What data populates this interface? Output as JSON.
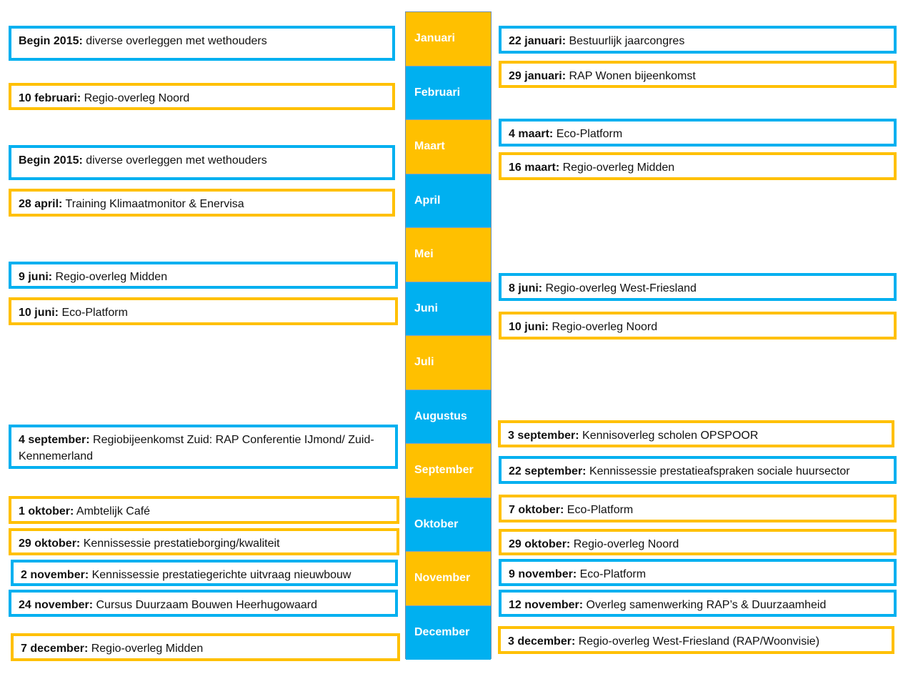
{
  "colors": {
    "blue": "#00B0F0",
    "orange": "#FFC000"
  },
  "months": [
    "Januari",
    "Februari",
    "Maart",
    "April",
    "Mei",
    "Juni",
    "Juli",
    "Augustus",
    "September",
    "Oktober",
    "November",
    "December"
  ],
  "left": [
    {
      "date": "Begin 2015:",
      "text": " diverse overleggen met wethouders"
    },
    {
      "date": "10 februari:",
      "text": " Regio-overleg Noord"
    },
    {
      "date": "Begin 2015:",
      "text": " diverse overleggen met wethouders"
    },
    {
      "date": "28 april:",
      "text": " Training Klimaatmonitor & Enervisa"
    },
    {
      "date": "9 juni:",
      "text": " Regio-overleg Midden"
    },
    {
      "date": "10 juni:",
      "text": " Eco-Platform"
    },
    {
      "date": "4 september:",
      "text": " Regiobijeenkomst Zuid: RAP Conferentie IJmond/ Zuid-Kennemerland"
    },
    {
      "date": "1 oktober:",
      "text": " Ambtelijk Café"
    },
    {
      "date": "29 oktober:",
      "text": " Kennissessie prestatieborging/kwaliteit"
    },
    {
      "date": "2 november:",
      "text": " Kennissessie prestatiegerichte uitvraag nieuwbouw"
    },
    {
      "date": "24 november:",
      "text": " Cursus Duurzaam Bouwen Heerhugowaard"
    },
    {
      "date": "7 december:",
      "text": " Regio-overleg Midden"
    }
  ],
  "right": [
    {
      "date": "22 januari:",
      "text": " Bestuurlijk jaarcongres"
    },
    {
      "date": "29 januari:",
      "text": " RAP Wonen bijeenkomst"
    },
    {
      "date": "4 maart:",
      "text": " Eco-Platform"
    },
    {
      "date": "16 maart:",
      "text": " Regio-overleg Midden"
    },
    {
      "date": "8 juni:",
      "text": " Regio-overleg West-Friesland"
    },
    {
      "date": "10 juni:",
      "text": " Regio-overleg Noord"
    },
    {
      "date": "3 september:",
      "text": " Kennisoverleg scholen OPSPOOR"
    },
    {
      "date": "22 september:",
      "text": " Kennissessie prestatieafspraken sociale huursector"
    },
    {
      "date": "7 oktober:",
      "text": " Eco-Platform"
    },
    {
      "date": "29 oktober:",
      "text": " Regio-overleg Noord"
    },
    {
      "date": "9 november:",
      "text": " Eco-Platform"
    },
    {
      "date": "12 november:",
      "text": " Overleg samenwerking RAP’s  & Duurzaamheid"
    },
    {
      "date": "3 december:",
      "text": " Regio-overleg West-Friesland (RAP/Woonvisie)"
    }
  ]
}
